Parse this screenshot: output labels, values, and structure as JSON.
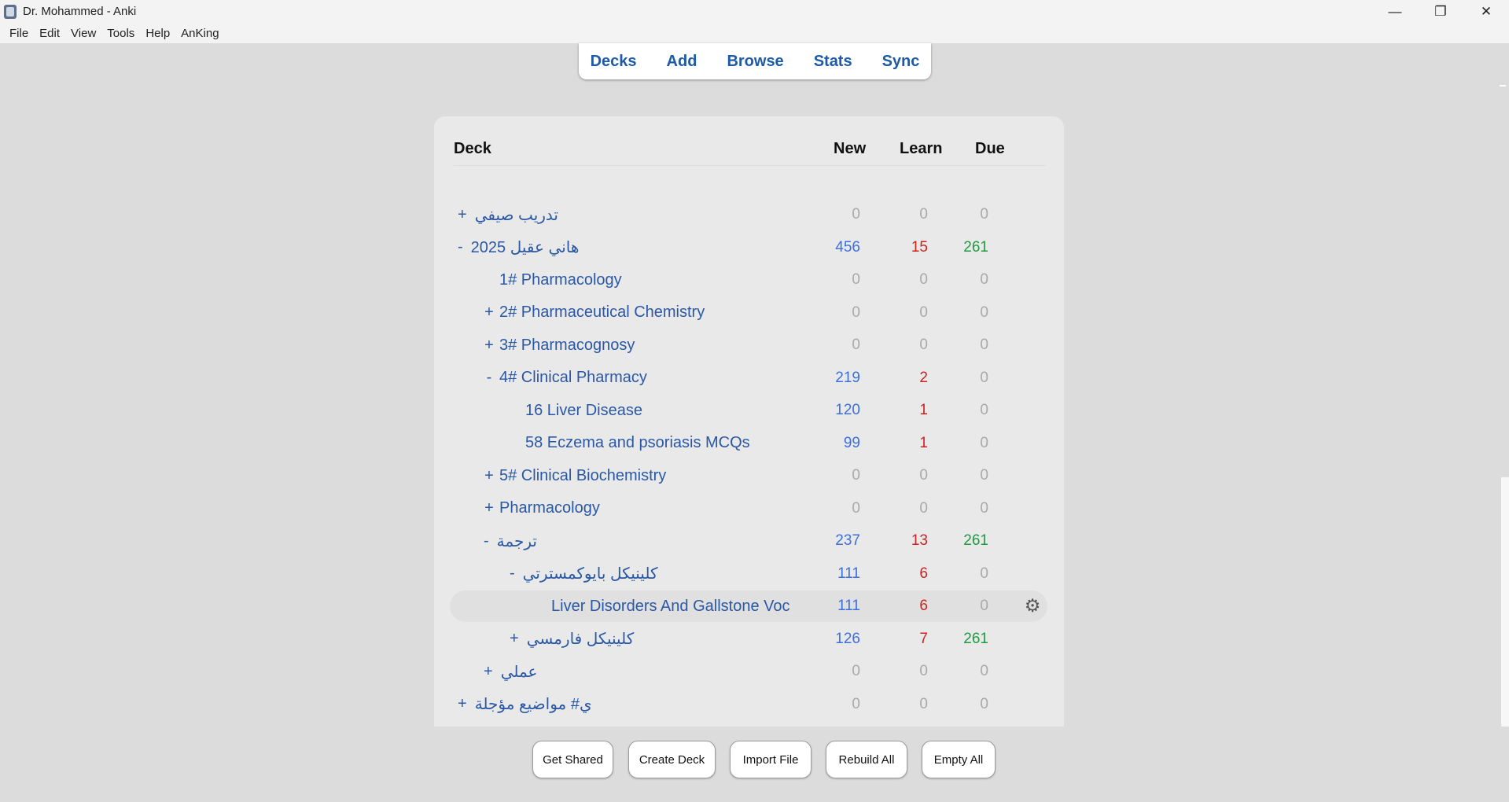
{
  "window": {
    "title": "Dr. Mohammed - Anki",
    "app_icon": "anki-icon",
    "controls": [
      "minimize-icon",
      "restore-icon",
      "close-icon"
    ]
  },
  "menu": [
    "File",
    "Edit",
    "View",
    "Tools",
    "Help",
    "AnKing"
  ],
  "toolbar": [
    "Decks",
    "Add",
    "Browse",
    "Stats",
    "Sync"
  ],
  "table": {
    "headers": {
      "deck": "Deck",
      "new": "New",
      "learn": "Learn",
      "due": "Due"
    },
    "rows": [
      {
        "name": "تدريب صيفي",
        "toggle": "+",
        "rtl": true,
        "depth": 0,
        "new": "0",
        "learn": "0",
        "due": "0"
      },
      {
        "name": "هاني عقيل 2025",
        "toggle": "-",
        "rtl": true,
        "depth": 0,
        "new": "456",
        "learn": "15",
        "due": "261"
      },
      {
        "name": "1# Pharmacology",
        "toggle": "",
        "rtl": false,
        "depth": 1,
        "new": "0",
        "learn": "0",
        "due": "0"
      },
      {
        "name": "2# Pharmaceutical Chemistry",
        "toggle": "+",
        "rtl": false,
        "depth": 1,
        "new": "0",
        "learn": "0",
        "due": "0"
      },
      {
        "name": "3# Pharmacognosy",
        "toggle": "+",
        "rtl": false,
        "depth": 1,
        "new": "0",
        "learn": "0",
        "due": "0"
      },
      {
        "name": "4# Clinical Pharmacy",
        "toggle": "-",
        "rtl": false,
        "depth": 1,
        "new": "219",
        "learn": "2",
        "due": "0"
      },
      {
        "name": "16 Liver Disease",
        "toggle": "",
        "rtl": false,
        "depth": 2,
        "new": "120",
        "learn": "1",
        "due": "0"
      },
      {
        "name": "58 Eczema and psoriasis MCQs",
        "toggle": "",
        "rtl": false,
        "depth": 2,
        "new": "99",
        "learn": "1",
        "due": "0"
      },
      {
        "name": "5# Clinical Biochemistry",
        "toggle": "+",
        "rtl": false,
        "depth": 1,
        "new": "0",
        "learn": "0",
        "due": "0"
      },
      {
        "name": "Pharmacology",
        "toggle": "+",
        "rtl": false,
        "depth": 1,
        "new": "0",
        "learn": "0",
        "due": "0"
      },
      {
        "name": "ترجمة",
        "toggle": "-",
        "rtl": true,
        "depth": 1,
        "new": "237",
        "learn": "13",
        "due": "261"
      },
      {
        "name": "كلينيكل بايوكمسترتي",
        "toggle": "-",
        "rtl": true,
        "depth": 2,
        "new": "111",
        "learn": "6",
        "due": "0"
      },
      {
        "name": "Liver Disorders And Gallstone Voc",
        "toggle": "",
        "rtl": false,
        "depth": 3,
        "new": "111",
        "learn": "6",
        "due": "0",
        "selected": true
      },
      {
        "name": "كلينيكل فارمسي",
        "toggle": "+",
        "rtl": true,
        "depth": 2,
        "new": "126",
        "learn": "7",
        "due": "261"
      },
      {
        "name": "عملي",
        "toggle": "+",
        "rtl": true,
        "depth": 1,
        "new": "0",
        "learn": "0",
        "due": "0"
      },
      {
        "name": "ي# مواضيع مؤجلة",
        "toggle": "+",
        "rtl": true,
        "depth": 0,
        "new": "0",
        "learn": "0",
        "due": "0"
      }
    ],
    "options_icon": "gear-icon"
  },
  "bottom_buttons": [
    "Get Shared",
    "Create Deck",
    "Import File",
    "Rebuild All",
    "Empty All"
  ],
  "colors": {
    "new": "#3b6fe0",
    "learn": "#cc2222",
    "due": "#1f9a40",
    "zero": "#a9a9a9",
    "link": "#2a58a5"
  }
}
